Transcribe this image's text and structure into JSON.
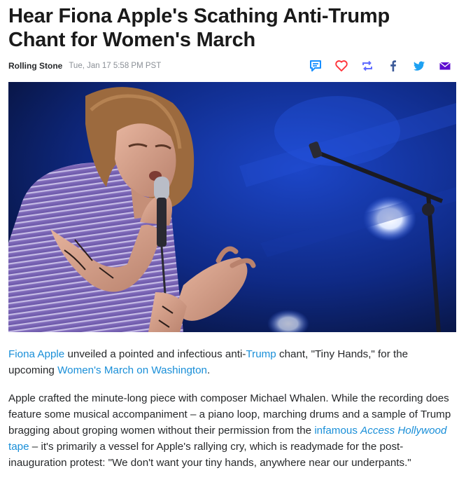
{
  "article": {
    "headline": "Hear Fiona Apple's Scathing Anti-Trump Chant for Women's March",
    "source": "Rolling Stone",
    "timestamp": "Tue, Jan 17 5:58 PM PST"
  },
  "share": {
    "icons": [
      "comment-icon",
      "heart-icon",
      "retweet-icon",
      "facebook-icon",
      "twitter-icon",
      "mail-icon"
    ],
    "colors": {
      "comment": "#188fff",
      "heart": "#ff333a",
      "retweet": "#5f6bff",
      "facebook": "#3b5998",
      "twitter": "#1da1f2",
      "mail": "#5f0fd0"
    }
  },
  "hero_image": {
    "alt": "Fiona Apple singing into a microphone on stage"
  },
  "body": {
    "p1": {
      "link_fiona": "Fiona Apple",
      "t1": " unveiled a pointed and infectious anti-",
      "link_trump": "Trump",
      "t2": " chant, \"Tiny Hands,\" for the upcoming ",
      "link_march": "Women's March on Washington",
      "t3": "."
    },
    "p2": {
      "t1": "Apple crafted the minute-long piece with composer Michael Whalen. While the recording does feature some musical accompaniment – a piano loop, marching drums and a sample of Trump bragging about groping women without their permission from the ",
      "link_a": "infamous ",
      "link_b": "Access Hollywood",
      "link_c": " tape",
      "t2": " – it's primarily a vessel for Apple's rallying cry, which is readymade for the post-inauguration protest: \"We don't want your tiny hands, anywhere near our underpants.\""
    }
  },
  "colors": {
    "link": "#1a8fd8",
    "headline": "#1a1a1a",
    "meta": "#8a8f96"
  }
}
